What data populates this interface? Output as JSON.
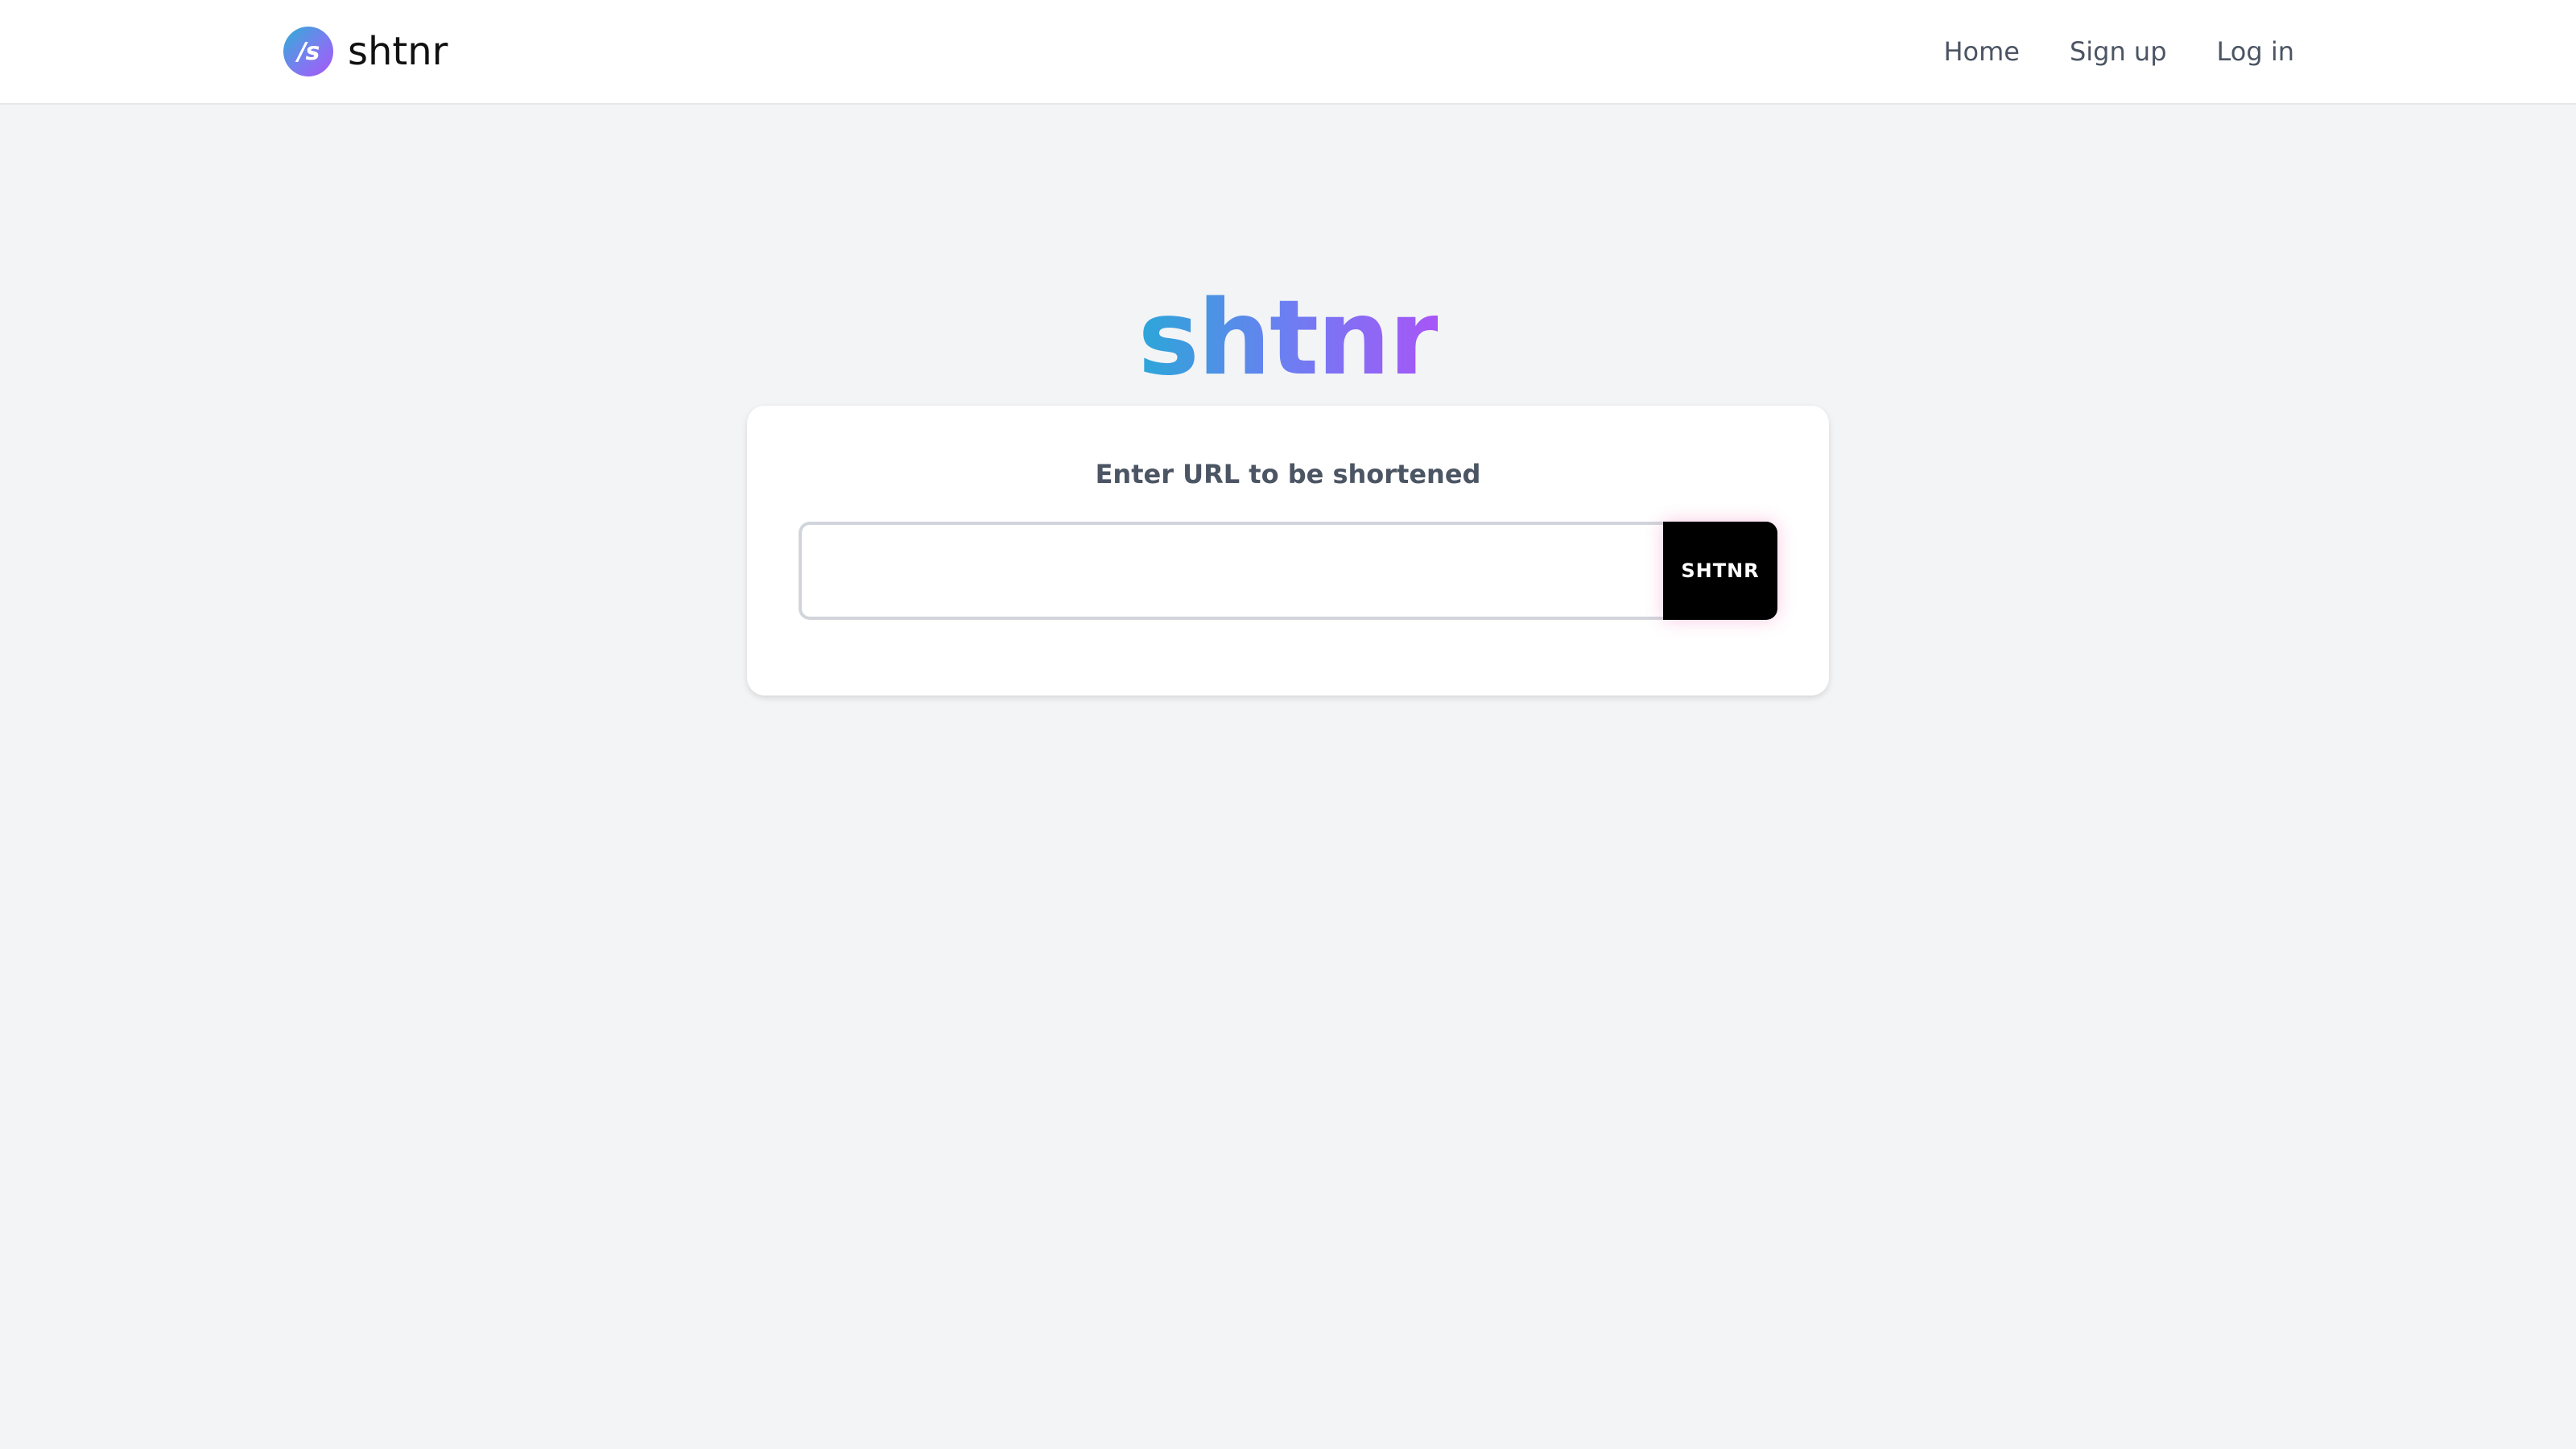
{
  "navbar": {
    "brand": {
      "logo_text": "/s",
      "name": "shtnr"
    },
    "links": [
      {
        "label": "Home"
      },
      {
        "label": "Sign up"
      },
      {
        "label": "Log in"
      }
    ]
  },
  "hero": {
    "title": "shtnr"
  },
  "shortener": {
    "label": "Enter URL to be shortened",
    "input_value": "",
    "submit_label": "SHTNR"
  },
  "colors": {
    "background": "#f3f4f6",
    "card": "#ffffff",
    "gradient_start": "#2ba7d8",
    "gradient_end": "#a855f7",
    "button": "#000000",
    "nav_text": "#4b5563"
  }
}
